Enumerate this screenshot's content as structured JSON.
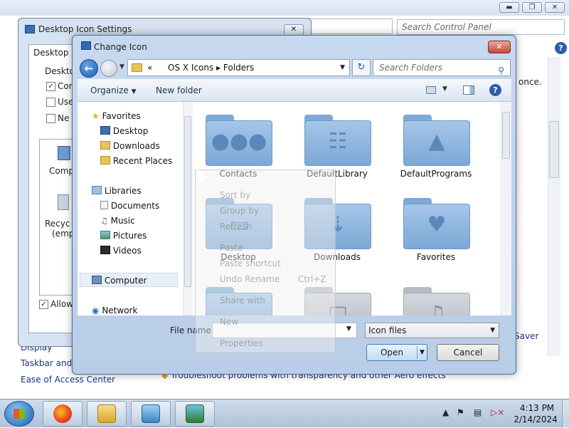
{
  "control_panel": {
    "window_buttons": {
      "minimize": "▬",
      "maximize": "❐",
      "close": "✕"
    },
    "search_placeholder": "Search Control Panel",
    "partial_text": "once.",
    "links": [
      "Display",
      "Taskbar and S",
      "Ease of Access Center"
    ],
    "troubleshoot": "Troubleshoot problems with transparency and other Aero effects",
    "screen_saver_partial": "Saver"
  },
  "desktop_icon_settings": {
    "title": "Desktop Icon Settings",
    "tab_partial": "Desktop Ico",
    "group_partial": "Desktop",
    "checks_partial": [
      "Com",
      "Use",
      "Ne"
    ],
    "icon_labels_partial": [
      "Comp",
      "Recyc",
      "(emp"
    ],
    "allow_partial": "Allow"
  },
  "change_icon": {
    "title": "Change Icon",
    "close": "✕",
    "address": {
      "separator": "«",
      "path": [
        "OS X Icons",
        "Folders"
      ]
    },
    "search_placeholder": "Search Folders",
    "toolbar": {
      "organize": "Organize",
      "new_folder": "New folder"
    },
    "nav": {
      "favorites": "Favorites",
      "favorites_items": [
        "Desktop",
        "Downloads",
        "Recent Places"
      ],
      "libraries": "Libraries",
      "libraries_items": [
        "Documents",
        "Music",
        "Pictures",
        "Videos"
      ],
      "computer": "Computer",
      "network": "Network"
    },
    "files": [
      {
        "label": "Contacts",
        "icon": "people-icon"
      },
      {
        "label": "DefaultLibrary",
        "icon": "library-icon"
      },
      {
        "label": "DefaultPrograms",
        "icon": "app-store-icon"
      },
      {
        "label": "Desktop",
        "icon": "monitor-icon"
      },
      {
        "label": "Downloads",
        "icon": "download-icon"
      },
      {
        "label": "Favorites",
        "icon": "heart-icon"
      }
    ],
    "ghost_menu": [
      "Sort by",
      "Group by",
      "Refresh",
      "Paste",
      "Paste shortcut",
      "Undo Rename",
      "Ctrl+Z",
      "Share with",
      "New",
      "Properties"
    ],
    "file_name_label": "File name:",
    "file_name_value": "",
    "file_type": "Icon files",
    "open_label": "Open",
    "cancel_label": "Cancel"
  },
  "taskbar": {
    "time": "4:13 PM",
    "date": "2/14/2024"
  },
  "colors": {
    "accent": "#2c5ea8",
    "folder_blue": "#7da8d6",
    "close_red": "#c4483a"
  }
}
